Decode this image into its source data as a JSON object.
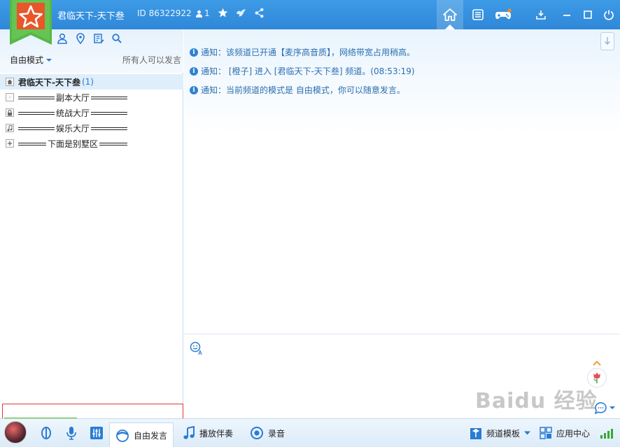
{
  "titlebar": {
    "channel_title": "君临天下-天下叁",
    "id_label": "ID 86322922",
    "user_count": "1"
  },
  "left": {
    "mode": "自由模式",
    "mode_note": "所有人可以发言",
    "root_channel": "君临天下-天下叁",
    "root_count": "(1)",
    "channels": [
      {
        "icon": "dot-icon",
        "label": "副本大厅"
      },
      {
        "icon": "lock-icon",
        "label": "统战大厅"
      },
      {
        "icon": "music-icon",
        "label": "娱乐大厅"
      },
      {
        "icon": "plus-icon",
        "label": "下面是别墅区"
      }
    ]
  },
  "chat": {
    "messages": [
      "通知：该频道已开通【麦序高音质】，网络带宽占用稍高。",
      "通知：  [橙子] 进入 [君临天下-天下叁] 频道。(08:53:19)",
      "通知：当前频道的模式是 自由模式，你可以随意发言。"
    ]
  },
  "input": {
    "watermark": "Baidu 经验"
  },
  "bottom": {
    "free_speech": "自由发言",
    "accompaniment": "播放伴奏",
    "record": "录音",
    "channel_template": "频道模板",
    "app_center": "应用中心"
  },
  "colors": {
    "titlebar": "#338ddb",
    "accent": "#2a7bd3",
    "badge_green": "#4caf50",
    "badge_orange": "#e8562a"
  }
}
